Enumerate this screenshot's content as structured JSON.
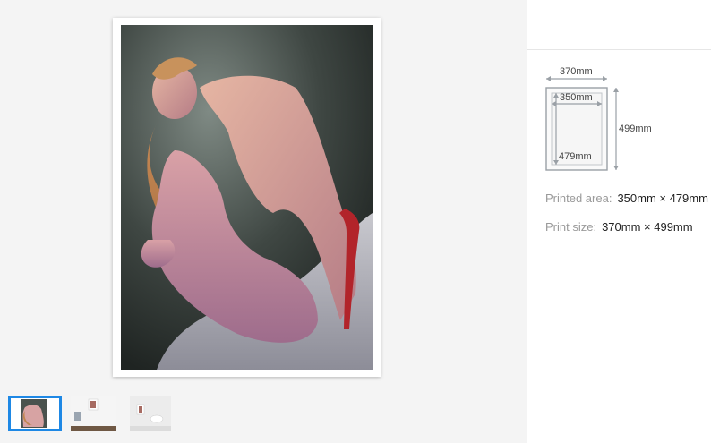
{
  "gallery": {
    "thumbnails": [
      {
        "name": "artwork-closeup",
        "selected": true
      },
      {
        "name": "room-mockup-small"
      },
      {
        "name": "room-mockup-white"
      }
    ],
    "accent_color": "#1e88e5"
  },
  "dimensions": {
    "outer_width": "370mm",
    "inner_width": "350mm",
    "outer_height": "499mm",
    "inner_height": "479mm"
  },
  "specs": {
    "printed_area_label": "Printed area:",
    "printed_area_value": "350mm × 479mm",
    "print_size_label": "Print size:",
    "print_size_value": "370mm × 499mm"
  }
}
